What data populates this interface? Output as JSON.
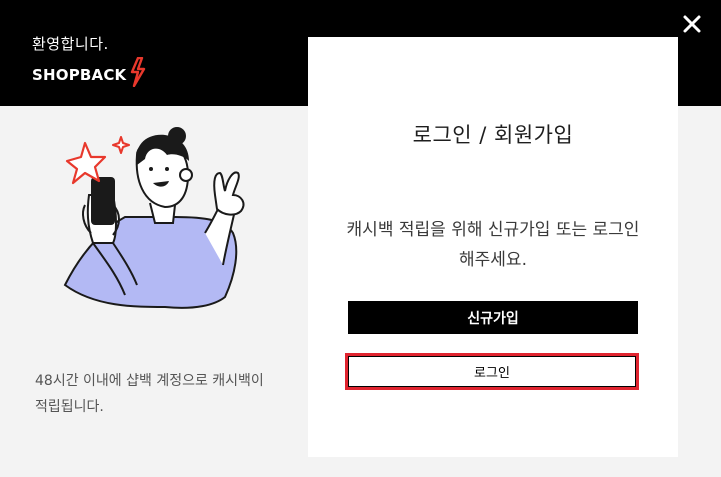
{
  "header": {
    "welcome": "환영합니다.",
    "logo_text": "SHOPBACK",
    "close_icon": "close-icon"
  },
  "left_panel": {
    "illustration": "woman-with-phone-illustration",
    "caption": "48시간 이내에 샵백 계정으로 캐시백이 적립됩니다."
  },
  "card": {
    "title": "로그인 / 회원가입",
    "description": "캐시백 적립을 위해 신규가입 또는 로그인해주세요.",
    "signup_label": "신규가입",
    "login_label": "로그인"
  },
  "colors": {
    "brand_red": "#e8382c",
    "accent_lavender": "#b3b9f4",
    "highlight_red": "#e0242f"
  }
}
